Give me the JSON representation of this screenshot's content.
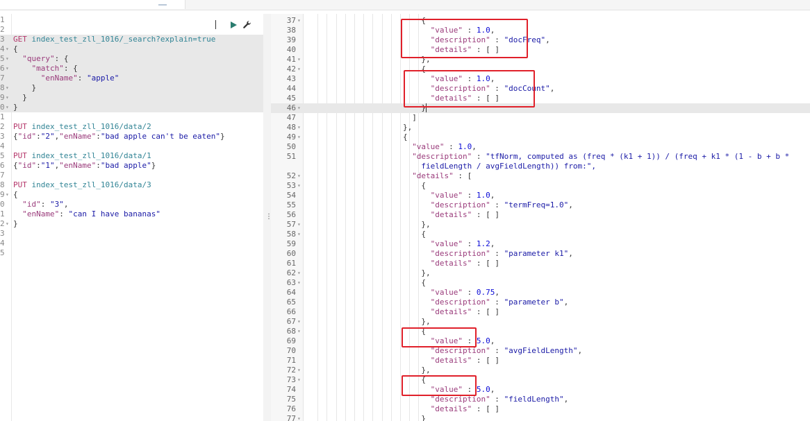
{
  "request_editor": {
    "lines": [
      {
        "num": "1"
      },
      {
        "num": "2"
      },
      {
        "num": "3",
        "highlight": true,
        "tokens": [
          {
            "t": "GET",
            "c": "m"
          },
          {
            "t": " "
          },
          {
            "t": "index_test_zll_1016/_search?explain=true",
            "c": "u"
          }
        ]
      },
      {
        "num": "4",
        "fold": true,
        "highlight": true,
        "tokens": [
          {
            "t": "{",
            "c": "p"
          }
        ]
      },
      {
        "num": "5",
        "fold": true,
        "highlight": true,
        "tokens": [
          {
            "t": "  "
          },
          {
            "t": "\"query\"",
            "c": "k"
          },
          {
            "t": ": {",
            "c": "p"
          }
        ]
      },
      {
        "num": "6",
        "fold": true,
        "highlight": true,
        "tokens": [
          {
            "t": "    "
          },
          {
            "t": "\"match\"",
            "c": "k"
          },
          {
            "t": ": {",
            "c": "p"
          }
        ]
      },
      {
        "num": "7",
        "highlight": true,
        "tokens": [
          {
            "t": "      "
          },
          {
            "t": "\"enName\"",
            "c": "k"
          },
          {
            "t": ": ",
            "c": "p"
          },
          {
            "t": "\"apple\"",
            "c": "s"
          }
        ]
      },
      {
        "num": "8",
        "fold": true,
        "highlight": true,
        "tokens": [
          {
            "t": "    }",
            "c": "p"
          }
        ]
      },
      {
        "num": "9",
        "fold": true,
        "highlight": true,
        "tokens": [
          {
            "t": "  }",
            "c": "p"
          }
        ]
      },
      {
        "num": "0",
        "fold": true,
        "highlight": true,
        "tokens": [
          {
            "t": "}",
            "c": "p"
          }
        ]
      },
      {
        "num": "1"
      },
      {
        "num": "2",
        "tokens": [
          {
            "t": "PUT",
            "c": "m"
          },
          {
            "t": " "
          },
          {
            "t": "index_test_zll_1016/data/2",
            "c": "u"
          }
        ]
      },
      {
        "num": "3",
        "tokens": [
          {
            "t": "{",
            "c": "p"
          },
          {
            "t": "\"id\"",
            "c": "k"
          },
          {
            "t": ":",
            "c": "p"
          },
          {
            "t": "\"2\"",
            "c": "s"
          },
          {
            "t": ",",
            "c": "p"
          },
          {
            "t": "\"enName\"",
            "c": "k"
          },
          {
            "t": ":",
            "c": "p"
          },
          {
            "t": "\"bad apple can't be eaten\"",
            "c": "s"
          },
          {
            "t": "}",
            "c": "p"
          }
        ]
      },
      {
        "num": "4"
      },
      {
        "num": "5",
        "tokens": [
          {
            "t": "PUT",
            "c": "m"
          },
          {
            "t": " "
          },
          {
            "t": "index_test_zll_1016/data/1",
            "c": "u"
          }
        ]
      },
      {
        "num": "6",
        "tokens": [
          {
            "t": "{",
            "c": "p"
          },
          {
            "t": "\"id\"",
            "c": "k"
          },
          {
            "t": ":",
            "c": "p"
          },
          {
            "t": "\"1\"",
            "c": "s"
          },
          {
            "t": ",",
            "c": "p"
          },
          {
            "t": "\"enName\"",
            "c": "k"
          },
          {
            "t": ":",
            "c": "p"
          },
          {
            "t": "\"bad apple\"",
            "c": "s"
          },
          {
            "t": "}",
            "c": "p"
          }
        ]
      },
      {
        "num": "7"
      },
      {
        "num": "8",
        "tokens": [
          {
            "t": "PUT",
            "c": "m"
          },
          {
            "t": " "
          },
          {
            "t": "index_test_zll_1016/data/3",
            "c": "u"
          }
        ]
      },
      {
        "num": "9",
        "fold": true,
        "tokens": [
          {
            "t": "{",
            "c": "p"
          }
        ]
      },
      {
        "num": "0",
        "tokens": [
          {
            "t": "  "
          },
          {
            "t": "\"id\"",
            "c": "k"
          },
          {
            "t": ": ",
            "c": "p"
          },
          {
            "t": "\"3\"",
            "c": "s"
          },
          {
            "t": ",",
            "c": "p"
          }
        ]
      },
      {
        "num": "1",
        "tokens": [
          {
            "t": "  "
          },
          {
            "t": "\"enName\"",
            "c": "k"
          },
          {
            "t": ": ",
            "c": "p"
          },
          {
            "t": "\"can I have bananas\"",
            "c": "s"
          }
        ]
      },
      {
        "num": "2",
        "fold": true,
        "tokens": [
          {
            "t": "}",
            "c": "p"
          }
        ]
      },
      {
        "num": "3"
      },
      {
        "num": "4"
      },
      {
        "num": "5"
      }
    ]
  },
  "splitter": {
    "grip": "⋮"
  },
  "response_viewer": {
    "lines": [
      {
        "num": "37",
        "fold": true,
        "indent": 12,
        "tokens": [
          {
            "t": "{",
            "c": "p"
          }
        ]
      },
      {
        "num": "38",
        "indent": 13,
        "tokens": [
          {
            "t": "\"value\"",
            "c": "k"
          },
          {
            "t": " : ",
            "c": "p"
          },
          {
            "t": "1.0",
            "c": "n"
          },
          {
            "t": ",",
            "c": "p"
          }
        ]
      },
      {
        "num": "39",
        "indent": 13,
        "tokens": [
          {
            "t": "\"description\"",
            "c": "k"
          },
          {
            "t": " : ",
            "c": "p"
          },
          {
            "t": "\"docFreq\"",
            "c": "s"
          },
          {
            "t": ",",
            "c": "p"
          }
        ]
      },
      {
        "num": "40",
        "indent": 13,
        "tokens": [
          {
            "t": "\"details\"",
            "c": "k"
          },
          {
            "t": " : [ ]",
            "c": "p"
          }
        ]
      },
      {
        "num": "41",
        "fold": true,
        "indent": 12,
        "tokens": [
          {
            "t": "},",
            "c": "p"
          }
        ]
      },
      {
        "num": "42",
        "fold": true,
        "indent": 12,
        "tokens": [
          {
            "t": "{",
            "c": "p"
          }
        ]
      },
      {
        "num": "43",
        "indent": 13,
        "tokens": [
          {
            "t": "\"value\"",
            "c": "k"
          },
          {
            "t": " : ",
            "c": "p"
          },
          {
            "t": "1.0",
            "c": "n"
          },
          {
            "t": ",",
            "c": "p"
          }
        ]
      },
      {
        "num": "44",
        "indent": 13,
        "tokens": [
          {
            "t": "\"description\"",
            "c": "k"
          },
          {
            "t": " : ",
            "c": "p"
          },
          {
            "t": "\"docCount\"",
            "c": "s"
          },
          {
            "t": ",",
            "c": "p"
          }
        ]
      },
      {
        "num": "45",
        "indent": 13,
        "tokens": [
          {
            "t": "\"details\"",
            "c": "k"
          },
          {
            "t": " : [ ]",
            "c": "p"
          }
        ]
      },
      {
        "num": "46",
        "fold": true,
        "indent": 12,
        "highlight": true,
        "tokens": [
          {
            "t": "}",
            "c": "p"
          }
        ]
      },
      {
        "num": "47",
        "indent": 11,
        "tokens": [
          {
            "t": "]",
            "c": "p"
          }
        ]
      },
      {
        "num": "48",
        "fold": true,
        "indent": 10,
        "tokens": [
          {
            "t": "},",
            "c": "p"
          }
        ]
      },
      {
        "num": "49",
        "fold": true,
        "indent": 10,
        "tokens": [
          {
            "t": "{",
            "c": "p"
          }
        ]
      },
      {
        "num": "50",
        "indent": 11,
        "tokens": [
          {
            "t": "\"value\"",
            "c": "k"
          },
          {
            "t": " : ",
            "c": "p"
          },
          {
            "t": "1.0",
            "c": "n"
          },
          {
            "t": ",",
            "c": "p"
          }
        ]
      },
      {
        "num": "51",
        "indent": 11,
        "tokens": [
          {
            "t": "\"description\"",
            "c": "k"
          },
          {
            "t": " : ",
            "c": "p"
          },
          {
            "t": "\"tfNorm, computed as (freq * (k1 + 1)) / (freq + k1 * (1 - b + b *",
            "c": "s"
          }
        ]
      },
      {
        "num": "",
        "indent": 12,
        "tokens": [
          {
            "t": "fieldLength / avgFieldLength)) from:\",",
            "c": "s"
          }
        ]
      },
      {
        "num": "52",
        "fold": true,
        "indent": 11,
        "tokens": [
          {
            "t": "\"details\"",
            "c": "k"
          },
          {
            "t": " : [",
            "c": "p"
          }
        ]
      },
      {
        "num": "53",
        "fold": true,
        "indent": 12,
        "tokens": [
          {
            "t": "{",
            "c": "p"
          }
        ]
      },
      {
        "num": "54",
        "indent": 13,
        "tokens": [
          {
            "t": "\"value\"",
            "c": "k"
          },
          {
            "t": " : ",
            "c": "p"
          },
          {
            "t": "1.0",
            "c": "n"
          },
          {
            "t": ",",
            "c": "p"
          }
        ]
      },
      {
        "num": "55",
        "indent": 13,
        "tokens": [
          {
            "t": "\"description\"",
            "c": "k"
          },
          {
            "t": " : ",
            "c": "p"
          },
          {
            "t": "\"termFreq=1.0\"",
            "c": "s"
          },
          {
            "t": ",",
            "c": "p"
          }
        ]
      },
      {
        "num": "56",
        "indent": 13,
        "tokens": [
          {
            "t": "\"details\"",
            "c": "k"
          },
          {
            "t": " : [ ]",
            "c": "p"
          }
        ]
      },
      {
        "num": "57",
        "fold": true,
        "indent": 12,
        "tokens": [
          {
            "t": "},",
            "c": "p"
          }
        ]
      },
      {
        "num": "58",
        "fold": true,
        "indent": 12,
        "tokens": [
          {
            "t": "{",
            "c": "p"
          }
        ]
      },
      {
        "num": "59",
        "indent": 13,
        "tokens": [
          {
            "t": "\"value\"",
            "c": "k"
          },
          {
            "t": " : ",
            "c": "p"
          },
          {
            "t": "1.2",
            "c": "n"
          },
          {
            "t": ",",
            "c": "p"
          }
        ]
      },
      {
        "num": "60",
        "indent": 13,
        "tokens": [
          {
            "t": "\"description\"",
            "c": "k"
          },
          {
            "t": " : ",
            "c": "p"
          },
          {
            "t": "\"parameter k1\"",
            "c": "s"
          },
          {
            "t": ",",
            "c": "p"
          }
        ]
      },
      {
        "num": "61",
        "indent": 13,
        "tokens": [
          {
            "t": "\"details\"",
            "c": "k"
          },
          {
            "t": " : [ ]",
            "c": "p"
          }
        ]
      },
      {
        "num": "62",
        "fold": true,
        "indent": 12,
        "tokens": [
          {
            "t": "},",
            "c": "p"
          }
        ]
      },
      {
        "num": "63",
        "fold": true,
        "indent": 12,
        "tokens": [
          {
            "t": "{",
            "c": "p"
          }
        ]
      },
      {
        "num": "64",
        "indent": 13,
        "tokens": [
          {
            "t": "\"value\"",
            "c": "k"
          },
          {
            "t": " : ",
            "c": "p"
          },
          {
            "t": "0.75",
            "c": "n"
          },
          {
            "t": ",",
            "c": "p"
          }
        ]
      },
      {
        "num": "65",
        "indent": 13,
        "tokens": [
          {
            "t": "\"description\"",
            "c": "k"
          },
          {
            "t": " : ",
            "c": "p"
          },
          {
            "t": "\"parameter b\"",
            "c": "s"
          },
          {
            "t": ",",
            "c": "p"
          }
        ]
      },
      {
        "num": "66",
        "indent": 13,
        "tokens": [
          {
            "t": "\"details\"",
            "c": "k"
          },
          {
            "t": " : [ ]",
            "c": "p"
          }
        ]
      },
      {
        "num": "67",
        "fold": true,
        "indent": 12,
        "tokens": [
          {
            "t": "},",
            "c": "p"
          }
        ]
      },
      {
        "num": "68",
        "fold": true,
        "indent": 12,
        "tokens": [
          {
            "t": "{",
            "c": "p"
          }
        ]
      },
      {
        "num": "69",
        "indent": 13,
        "tokens": [
          {
            "t": "\"value\"",
            "c": "k"
          },
          {
            "t": " : ",
            "c": "p"
          },
          {
            "t": "5.0",
            "c": "n"
          },
          {
            "t": ",",
            "c": "p"
          }
        ]
      },
      {
        "num": "70",
        "indent": 13,
        "tokens": [
          {
            "t": "\"description\"",
            "c": "k"
          },
          {
            "t": " : ",
            "c": "p"
          },
          {
            "t": "\"avgFieldLength\"",
            "c": "s"
          },
          {
            "t": ",",
            "c": "p"
          }
        ]
      },
      {
        "num": "71",
        "indent": 13,
        "tokens": [
          {
            "t": "\"details\"",
            "c": "k"
          },
          {
            "t": " : [ ]",
            "c": "p"
          }
        ]
      },
      {
        "num": "72",
        "fold": true,
        "indent": 12,
        "tokens": [
          {
            "t": "},",
            "c": "p"
          }
        ]
      },
      {
        "num": "73",
        "fold": true,
        "indent": 12,
        "tokens": [
          {
            "t": "{",
            "c": "p"
          }
        ]
      },
      {
        "num": "74",
        "indent": 13,
        "tokens": [
          {
            "t": "\"value\"",
            "c": "k"
          },
          {
            "t": " : ",
            "c": "p"
          },
          {
            "t": "5.0",
            "c": "n"
          },
          {
            "t": ",",
            "c": "p"
          }
        ]
      },
      {
        "num": "75",
        "indent": 13,
        "tokens": [
          {
            "t": "\"description\"",
            "c": "k"
          },
          {
            "t": " : ",
            "c": "p"
          },
          {
            "t": "\"fieldLength\"",
            "c": "s"
          },
          {
            "t": ",",
            "c": "p"
          }
        ]
      },
      {
        "num": "76",
        "indent": 13,
        "tokens": [
          {
            "t": "\"details\"",
            "c": "k"
          },
          {
            "t": " : [ ]",
            "c": "p"
          }
        ]
      },
      {
        "num": "77",
        "fold": true,
        "indent": 12,
        "tokens": [
          {
            "t": "}",
            "c": "p"
          }
        ]
      }
    ]
  },
  "annotations": {
    "color": "#e0202a"
  },
  "icons": {
    "run": "play-icon",
    "settings": "wrench-icon"
  }
}
